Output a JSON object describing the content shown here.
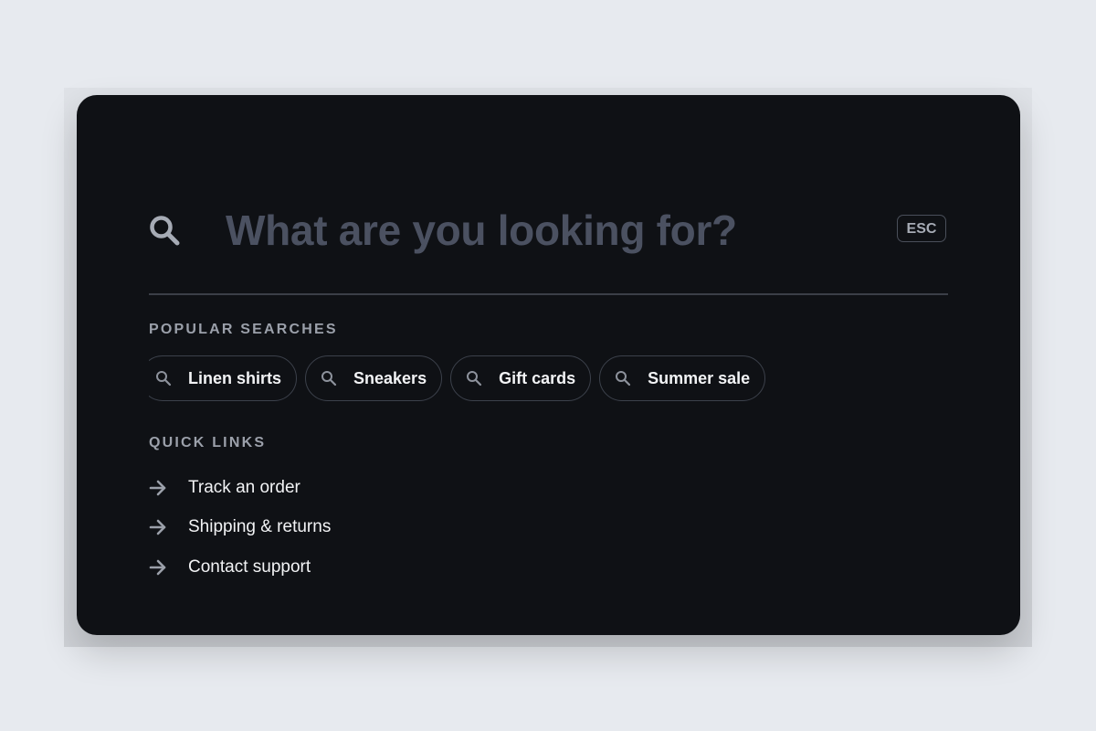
{
  "search": {
    "placeholder": "What are you looking for?",
    "value": "",
    "esc_label": "ESC"
  },
  "popular": {
    "heading": "POPULAR SEARCHES",
    "chips": [
      {
        "label": "Linen shirts"
      },
      {
        "label": "Sneakers"
      },
      {
        "label": "Gift cards"
      },
      {
        "label": "Summer sale"
      }
    ]
  },
  "quick_links": {
    "heading": "QUICK LINKS",
    "items": [
      {
        "label": "Track an order"
      },
      {
        "label": "Shipping & returns"
      },
      {
        "label": "Contact support"
      }
    ]
  },
  "icons": {
    "search": "search-icon",
    "chip": "search-icon",
    "link": "arrow-right-icon"
  },
  "colors": {
    "page_background": "#e7eaef",
    "panel_background": "#0f1115",
    "placeholder_text": "#4b5161",
    "muted_text": "#9ba0aa",
    "primary_text": "#f2f3f5",
    "border": "#3c414b"
  }
}
